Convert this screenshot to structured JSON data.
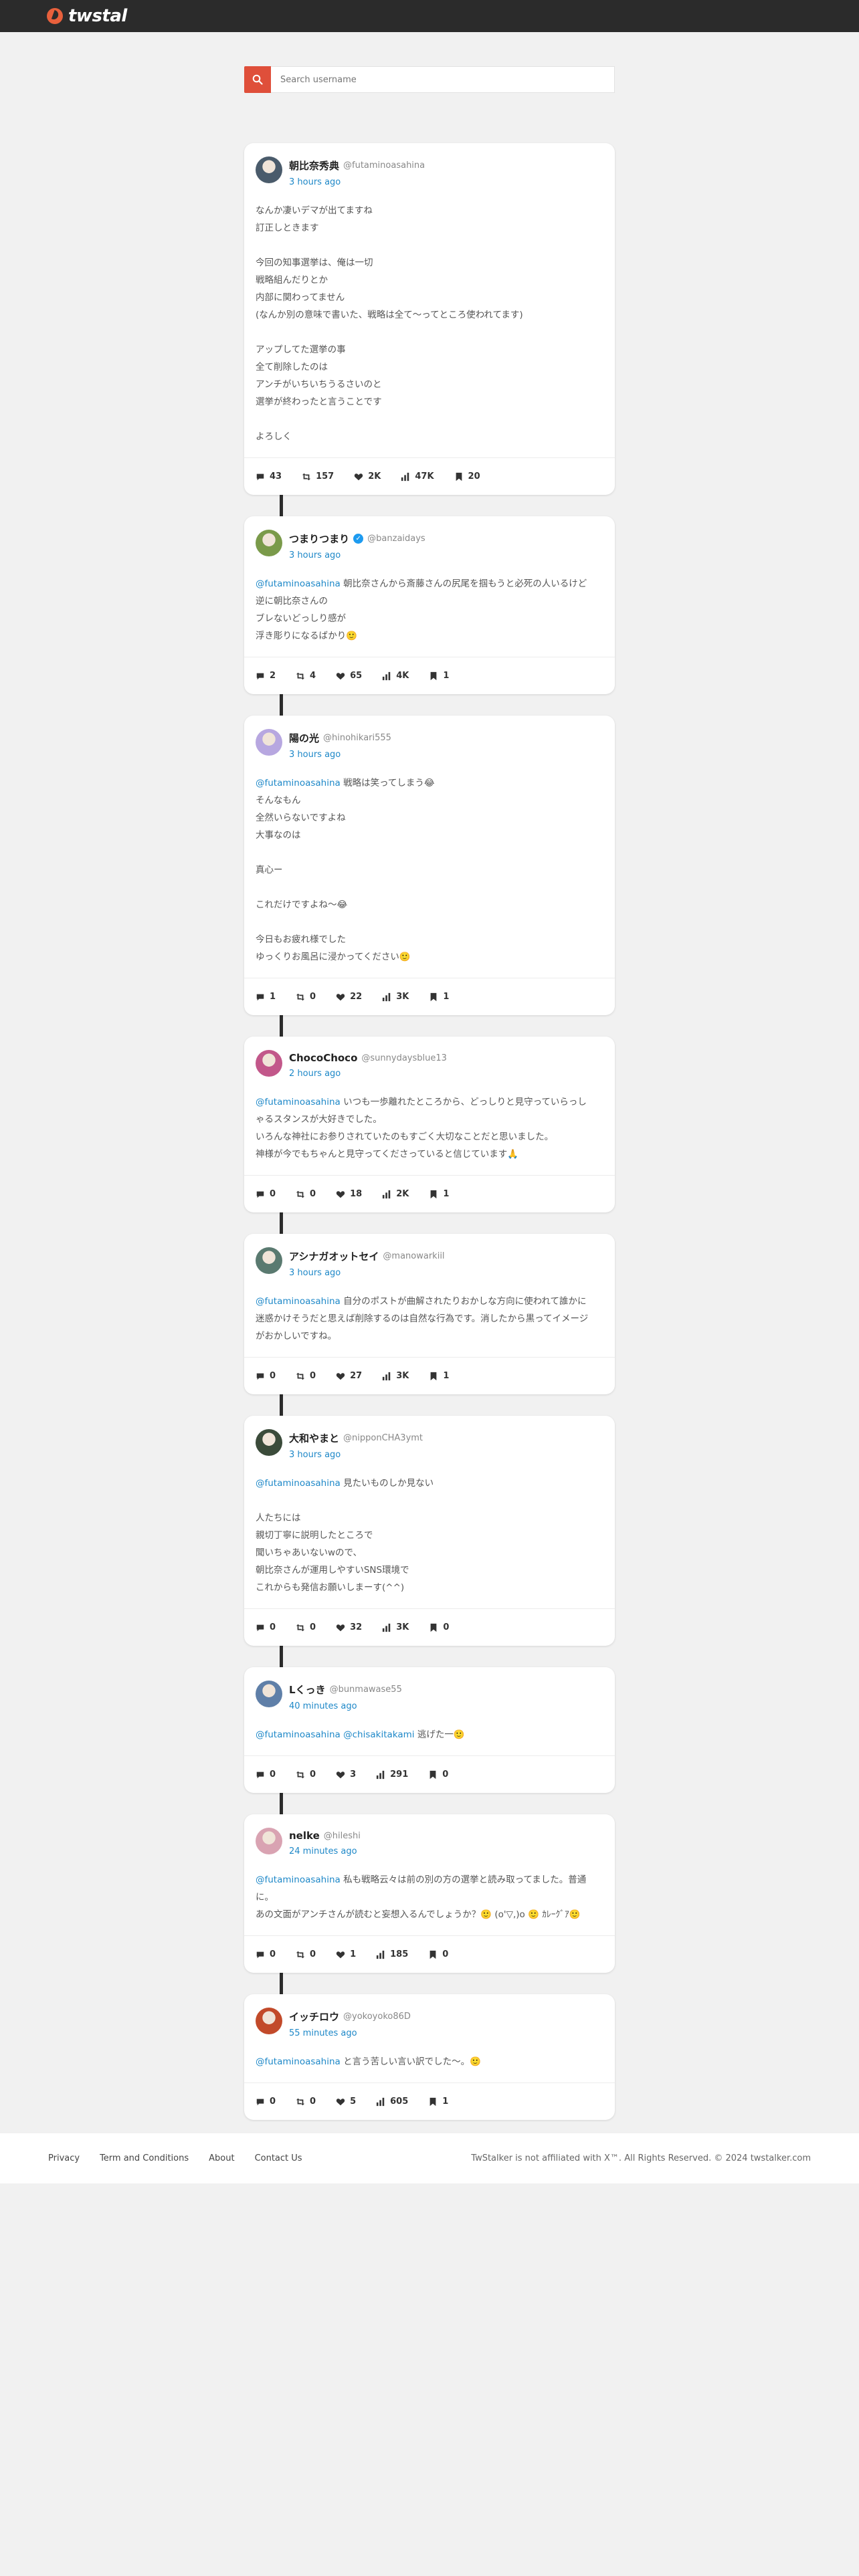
{
  "header": {
    "logo_text": "twstal"
  },
  "search": {
    "placeholder": "Search username"
  },
  "actions_icons": [
    "comment-icon",
    "retweet-icon",
    "heart-icon",
    "views-icon",
    "bookmark-icon"
  ],
  "posts": [
    {
      "name": "朝比奈秀典",
      "handle": "@futaminoasahina",
      "verified": false,
      "time": "3 hours ago",
      "mention": "",
      "lines": [
        "なんか凄いデマが出てますね",
        "訂正しときます",
        "",
        "今回の知事選挙は、俺は一切",
        "戦略組んだりとか",
        "内部に関わってません",
        "(なんか別の意味で書いた、戦略は全て〜ってところ使われてます)",
        "",
        "アップしてた選挙の事",
        "全て削除したのは",
        "アンチがいちいちうるさいのと",
        "選挙が終わったと言うことです",
        "",
        "よろしく"
      ],
      "stats": {
        "replies": "43",
        "retweets": "157",
        "likes": "2K",
        "views": "47K",
        "bookmarks": "20"
      }
    },
    {
      "name": "つまりつまり",
      "handle": "@banzaidays",
      "verified": true,
      "time": "3 hours ago",
      "mention": "@futaminoasahina",
      "lines": [
        " 朝比奈さんから斎藤さんの尻尾を掴もうと必死の人いるけど",
        "逆に朝比奈さんの",
        "ブレないどっしり感が",
        "浮き彫りになるばかり🙂"
      ],
      "stats": {
        "replies": "2",
        "retweets": "4",
        "likes": "65",
        "views": "4K",
        "bookmarks": "1"
      }
    },
    {
      "name": "陽の光",
      "handle": "@hinohikari555",
      "verified": false,
      "time": "3 hours ago",
      "mention": "@futaminoasahina",
      "lines": [
        " 戦略は笑ってしまう😂",
        "そんなもん",
        "全然いらないですよね",
        "大事なのは",
        "",
        "真心ー",
        "",
        "これだけですよね〜😂",
        "",
        "今日もお疲れ様でした",
        "ゆっくりお風呂に浸かってください🙂"
      ],
      "stats": {
        "replies": "1",
        "retweets": "0",
        "likes": "22",
        "views": "3K",
        "bookmarks": "1"
      }
    },
    {
      "name": "ChocoChoco",
      "handle": "@sunnydaysblue13",
      "verified": false,
      "time": "2 hours ago",
      "mention": "@futaminoasahina",
      "lines": [
        " いつも一歩離れたところから、どっしりと見守っていらっし",
        "ゃるスタンスが大好きでした。",
        "いろんな神社にお参りされていたのもすごく大切なことだと思いました。",
        "神様が今でもちゃんと見守ってくださっていると信じています🙏"
      ],
      "stats": {
        "replies": "0",
        "retweets": "0",
        "likes": "18",
        "views": "2K",
        "bookmarks": "1"
      }
    },
    {
      "name": "アシナガオットセイ",
      "handle": "@manowarkiil",
      "verified": false,
      "time": "3 hours ago",
      "mention": "@futaminoasahina",
      "lines": [
        " 自分のポストが曲解されたりおかしな方向に使われて誰かに",
        "迷惑かけそうだと思えば削除するのは自然な行為です。消したから黒ってイメージ",
        "がおかしいですね。"
      ],
      "stats": {
        "replies": "0",
        "retweets": "0",
        "likes": "27",
        "views": "3K",
        "bookmarks": "1"
      }
    },
    {
      "name": "大和やまと",
      "handle": "@nipponCHA3ymt",
      "verified": false,
      "time": "3 hours ago",
      "mention": "@futaminoasahina",
      "lines": [
        " 見たいものしか見ない",
        "",
        "人たちには",
        "親切丁寧に説明したところで",
        "聞いちゃあいないwので、",
        "朝比奈さんが運用しやすいSNS環境で",
        "これからも発信お願いしまーす(^^)"
      ],
      "stats": {
        "replies": "0",
        "retweets": "0",
        "likes": "32",
        "views": "3K",
        "bookmarks": "0"
      }
    },
    {
      "name": "Lくっき",
      "handle": "@bunmawase55",
      "verified": false,
      "time": "40 minutes ago",
      "mention": "@futaminoasahina @chisakitakami",
      "lines": [
        " 逃げた一🙂"
      ],
      "stats": {
        "replies": "0",
        "retweets": "0",
        "likes": "3",
        "views": "291",
        "bookmarks": "0"
      }
    },
    {
      "name": "nelke",
      "handle": "@hileshi",
      "verified": false,
      "time": "24 minutes ago",
      "mention": "@futaminoasahina",
      "lines": [
        " 私も戦略云々は前の別の方の選挙と読み取ってました。普通",
        "に。",
        "あの文面がアンチさんが読むと妄想入るんでしょうか？🙂 (o'▽,)o 🙂 ｶﾚｰｸﾞｱ🙂"
      ],
      "stats": {
        "replies": "0",
        "retweets": "0",
        "likes": "1",
        "views": "185",
        "bookmarks": "0"
      }
    },
    {
      "name": "イッチロウ",
      "handle": "@yokoyoko86D",
      "verified": false,
      "time": "55 minutes ago",
      "mention": "@futaminoasahina",
      "lines": [
        " と言う苦しい言い訳でした〜。🙂"
      ],
      "stats": {
        "replies": "0",
        "retweets": "0",
        "likes": "5",
        "views": "605",
        "bookmarks": "1"
      }
    }
  ],
  "footer": {
    "links": [
      "Privacy",
      "Term and Conditions",
      "About",
      "Contact Us"
    ],
    "copyright": "TwStalker is not affiliated with X™. All Rights Reserved. © 2024 twstalker.com"
  },
  "colors": {
    "accent": "#df4f3a",
    "link": "#1e88c8",
    "header_bg": "#2b2b2b"
  }
}
